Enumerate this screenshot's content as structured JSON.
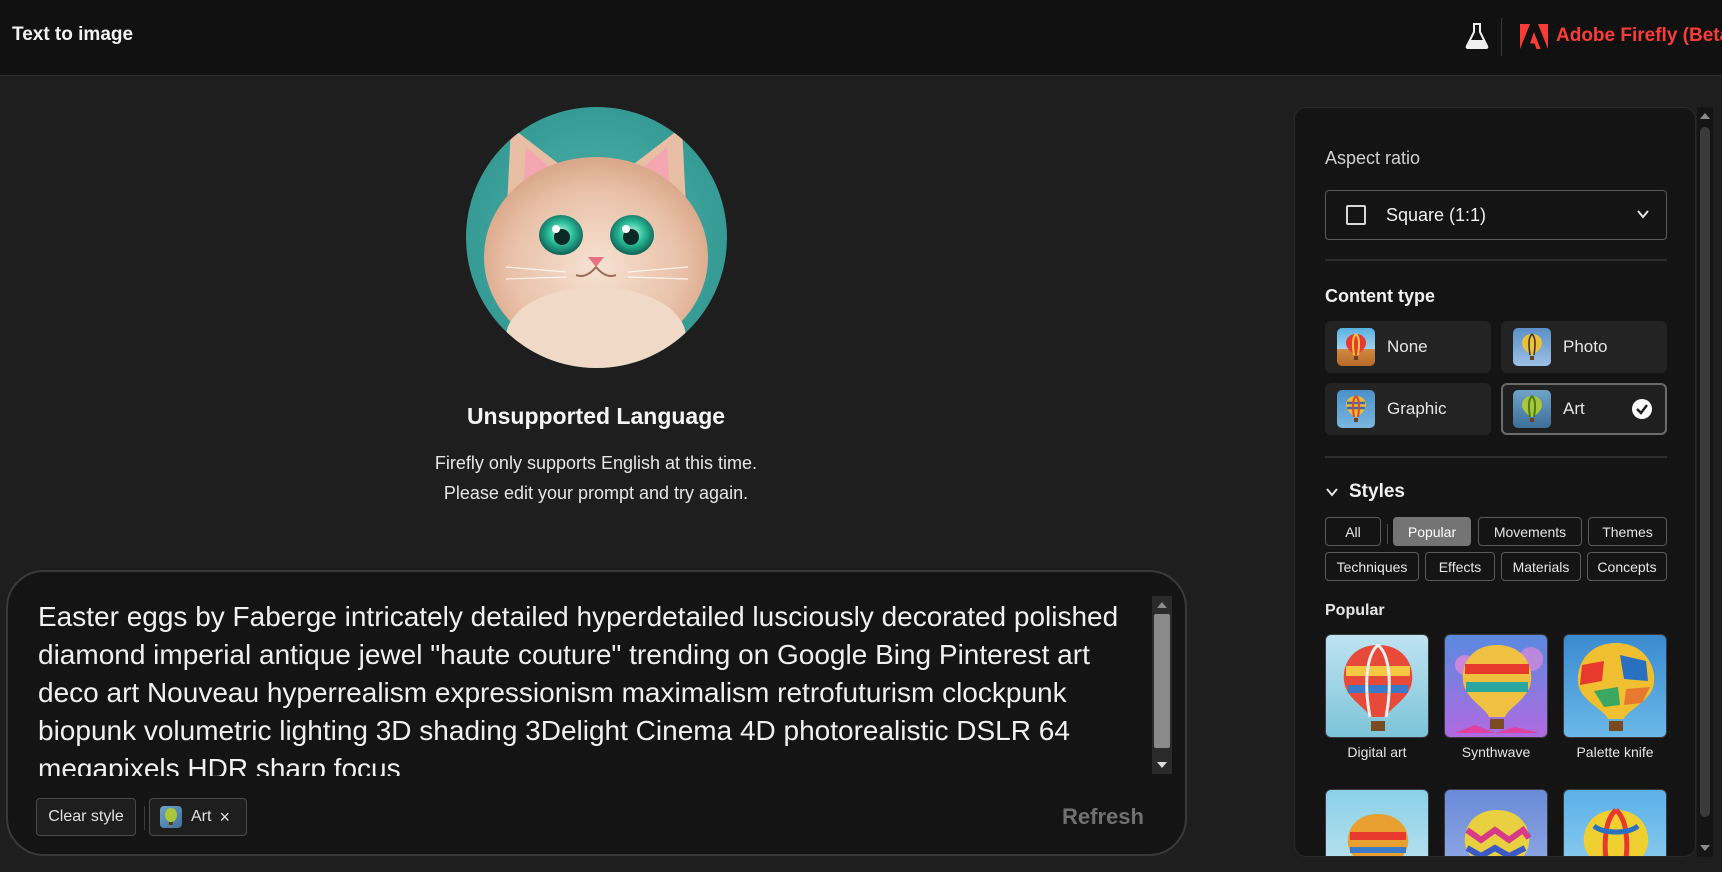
{
  "header": {
    "title": "Text to image",
    "brand": "Adobe Firefly (Beta)",
    "icons": [
      "beaker-icon",
      "adobe-logo-icon"
    ],
    "brand_color": "#fa3c37"
  },
  "message": {
    "title": "Unsupported Language",
    "line1": "Firefly only supports English at this time.",
    "line2": "Please edit your prompt and try again."
  },
  "prompt": {
    "text": "Easter eggs by Faberge intricately detailed hyperdetailed lusciously decorated polished diamond imperial antique jewel \"haute couture\" trending on Google Bing Pinterest art deco art Nouveau hyperrealism expressionism maximalism retrofuturism clockpunk biopunk volumetric lighting 3D shading 3Delight Cinema 4D photorealistic DSLR 64 megapixels HDR sharp focus",
    "clear_style_label": "Clear style",
    "applied_style": "Art",
    "remove_glyph": "×",
    "refresh_label": "Refresh"
  },
  "panel": {
    "aspect_ratio_label": "Aspect ratio",
    "aspect_ratio_value": "Square (1:1)",
    "content_type_label": "Content type",
    "content_types": [
      {
        "label": "None",
        "selected": false
      },
      {
        "label": "Photo",
        "selected": false
      },
      {
        "label": "Graphic",
        "selected": false
      },
      {
        "label": "Art",
        "selected": true
      }
    ],
    "styles_label": "Styles",
    "filters": [
      {
        "label": "All",
        "active": false
      },
      {
        "label": "Popular",
        "active": true
      },
      {
        "label": "Movements",
        "active": false
      },
      {
        "label": "Themes",
        "active": false
      },
      {
        "label": "Techniques",
        "active": false
      },
      {
        "label": "Effects",
        "active": false
      },
      {
        "label": "Materials",
        "active": false
      },
      {
        "label": "Concepts",
        "active": false
      }
    ],
    "popular_label": "Popular",
    "popular_styles": [
      {
        "label": "Digital art"
      },
      {
        "label": "Synthwave"
      },
      {
        "label": "Palette knife"
      }
    ]
  }
}
